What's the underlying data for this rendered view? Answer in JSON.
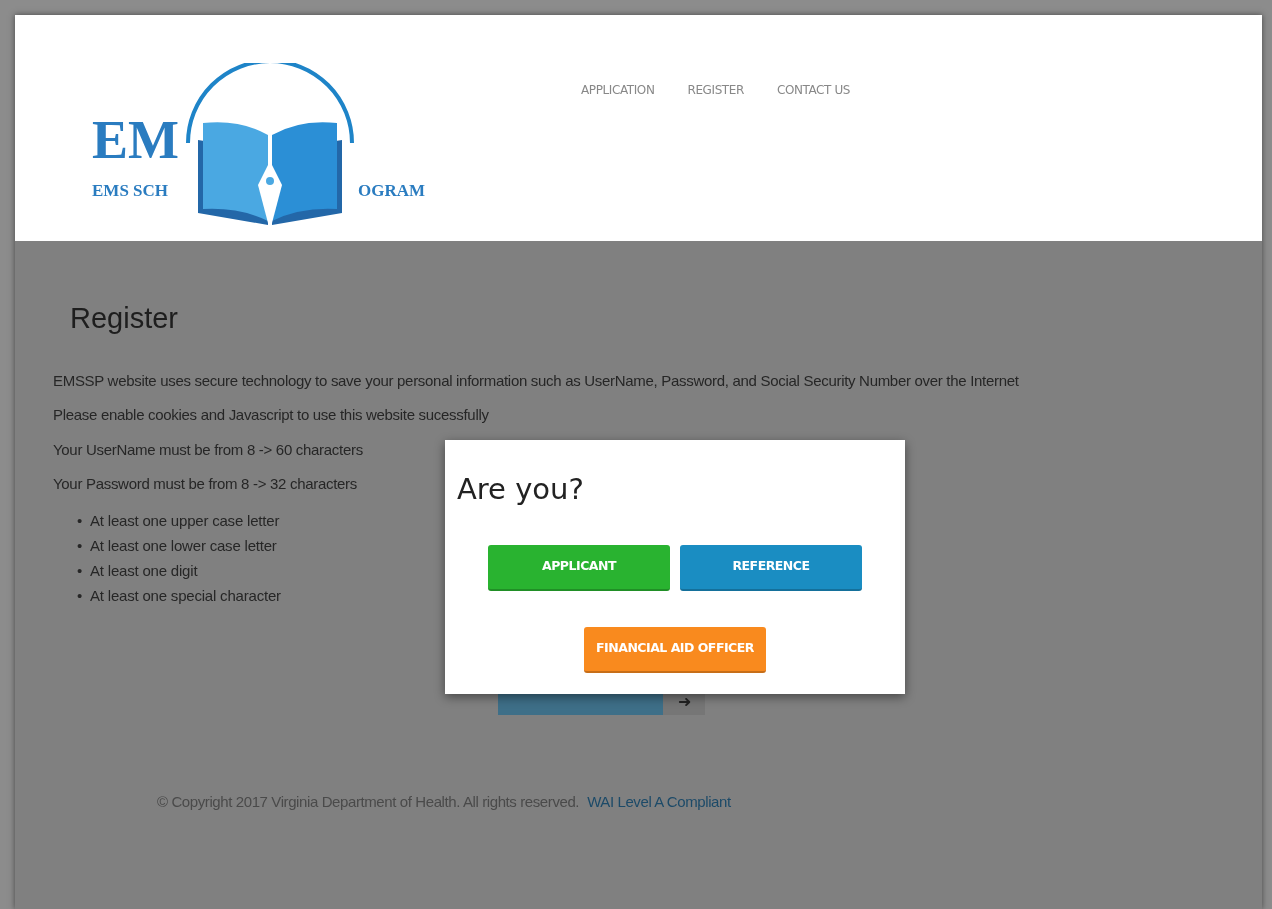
{
  "logo": {
    "letters": "EM",
    "line_start": "EMS SCH",
    "line_end": "OGRAM"
  },
  "nav": [
    "APPLICATION",
    "REGISTER",
    "CONTACT US"
  ],
  "heading": "Register",
  "paragraphs": [
    "EMSSP website uses secure technology to save your personal information such as UserName, Password, and Social Security Number over the Internet",
    "Please enable cookies and Javascript to use this website sucessfully",
    "Your UserName must be from 8 -> 60 characters",
    "Your Password must be from 8 -> 32 characters"
  ],
  "rule_marker": "•",
  "rules": [
    "At least one upper case letter",
    "At least one lower case letter",
    "At least one digit",
    "At least one special character"
  ],
  "next_button": {
    "arrow": "➜"
  },
  "footer": {
    "copyright": "© Copyright 2017 Virginia Department of Health. All rights reserved.",
    "link": "WAI Level A Compliant"
  },
  "modal": {
    "title": "Are you?",
    "buttons": [
      {
        "label": "APPLICANT",
        "color": "#29b330"
      },
      {
        "label": "REFERENCE",
        "color": "#1a8dc2"
      },
      {
        "label": "FINANCIAL AID OFFICER",
        "color": "#f98a1e"
      }
    ]
  }
}
